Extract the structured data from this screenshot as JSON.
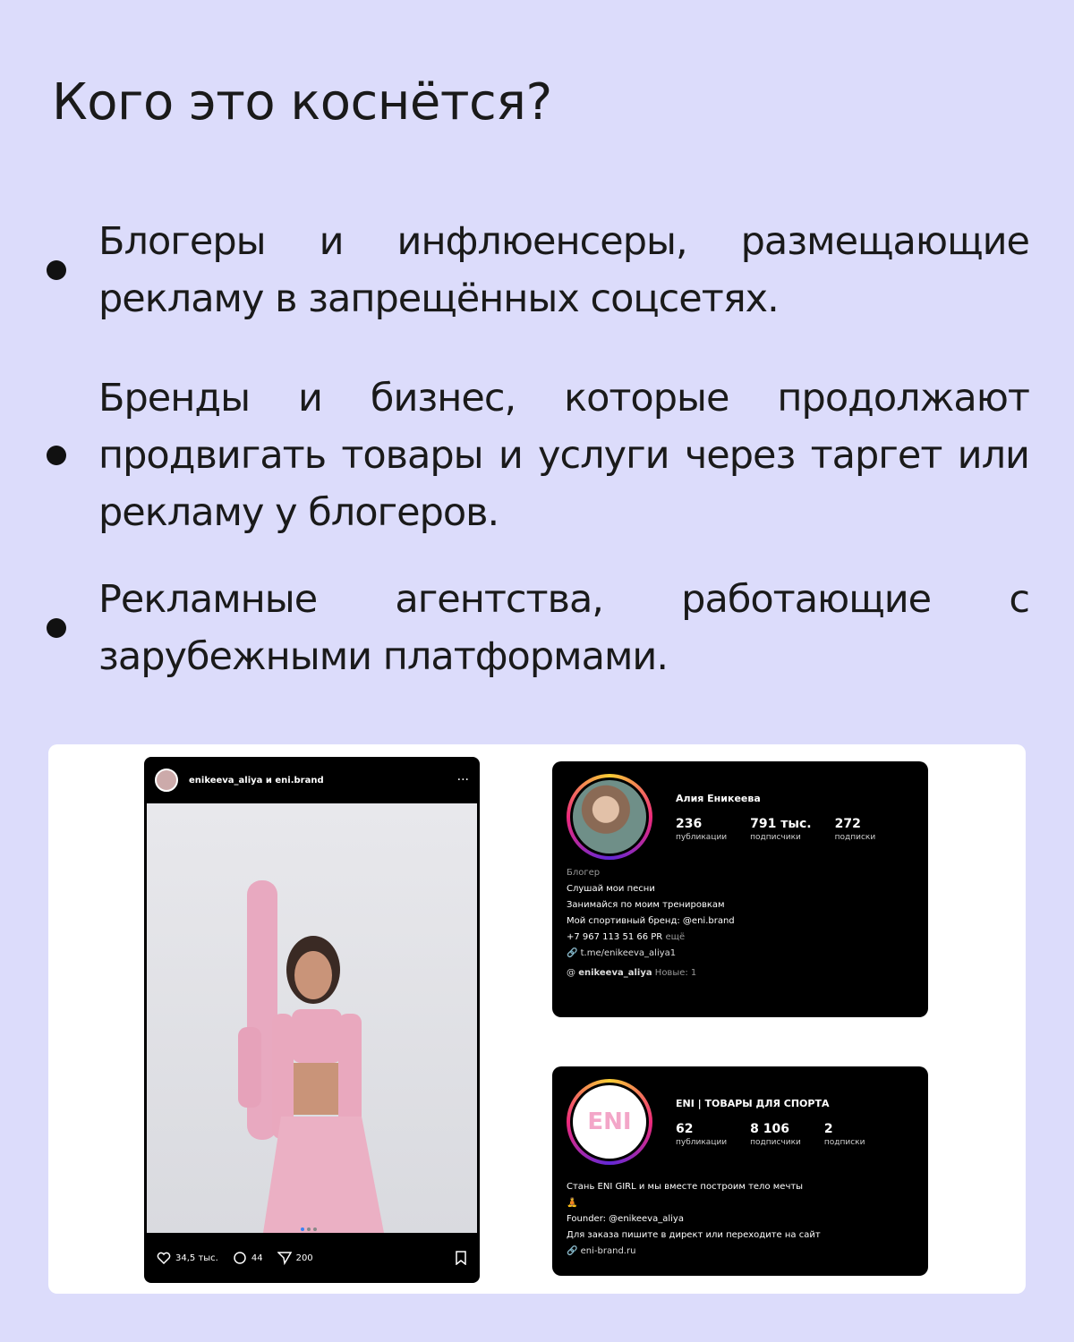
{
  "title": "Кого это коснётся?",
  "bullets": [
    "Блогеры и инфлюенсеры, размещающие рекламу в запрещённых соцсетях.",
    "Бренды и бизнес, которые продолжают продвигать товары и услуги через таргет или рекламу у блогеров.",
    "Рекламные агентства, работающие с зарубежными платформами."
  ],
  "post": {
    "users": "enikeeva_aliya и eni.brand",
    "likes": "34,5 тыс.",
    "comments": "44",
    "shares": "200"
  },
  "profile1": {
    "name": "Алия Еникеева",
    "posts_n": "236",
    "posts_l": "публикации",
    "followers_n": "791 тыс.",
    "followers_l": "подписчики",
    "following_n": "272",
    "following_l": "подписки",
    "category": "Блогер",
    "bio1": "Слушай мои песни",
    "bio2": "Занимайся по моим тренировкам",
    "bio3": "Мой спортивный бренд: @eni.brand",
    "bio4": "+7 967 113 51 66 PR",
    "more": "ещё",
    "link": "t.me/enikeeva_aliya1",
    "threads": "enikeeva_aliya",
    "threads_new": "Новые: 1"
  },
  "profile2": {
    "name": "ENI | ТОВАРЫ ДЛЯ СПОРТА",
    "logo": "ENI",
    "posts_n": "62",
    "posts_l": "публикации",
    "followers_n": "8 106",
    "followers_l": "подписчики",
    "following_n": "2",
    "following_l": "подписки",
    "bio1": "Стань ENI GIRL и мы вместе построим тело мечты",
    "bio2": "Founder: @enikeeva_aliya",
    "bio3": "Для заказа пишите в директ или переходите на сайт",
    "link": "eni-brand.ru"
  }
}
